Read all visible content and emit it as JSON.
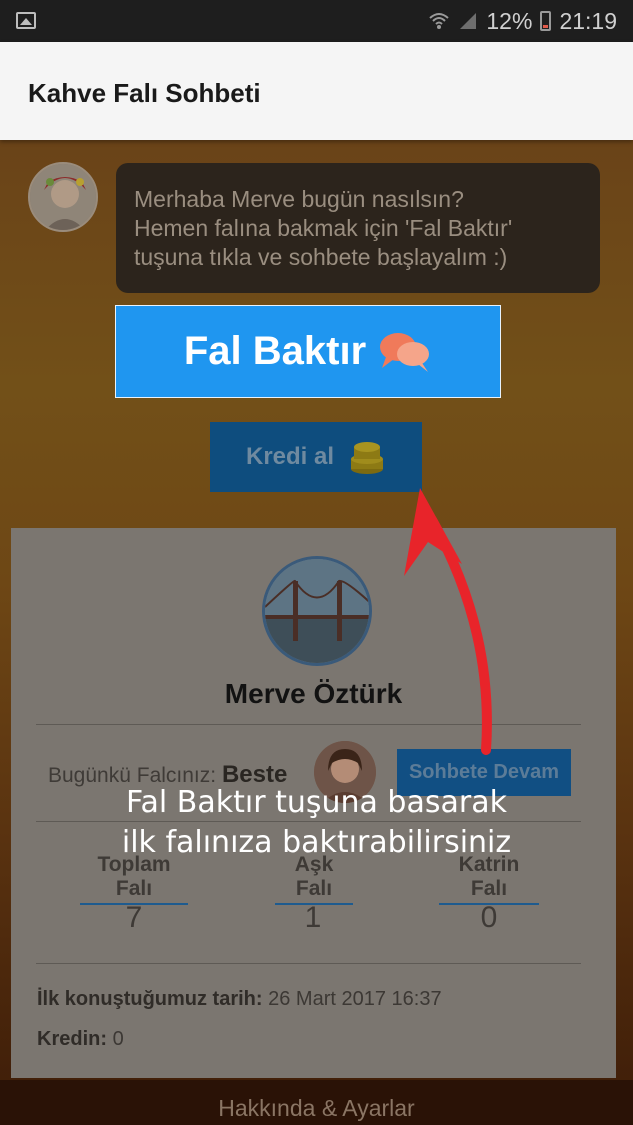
{
  "status_bar": {
    "battery": "12%",
    "time": "21:19",
    "icons": [
      "image-icon",
      "wifi-icon",
      "signal-icon",
      "battery-icon"
    ]
  },
  "app_bar": {
    "title": "Kahve Falı Sohbeti"
  },
  "chat": {
    "line1": "Merhaba  Merve      bugün nasılsın?",
    "line2": "Hemen falına bakmak için 'Fal Baktır'",
    "line3": "tuşuna tıkla ve sohbete başlayalım :)"
  },
  "buttons": {
    "fal_baktir": "Fal Baktır",
    "kredi_al": "Kredi al",
    "sohbete_devam": "Sohbete Devam"
  },
  "profile": {
    "name": "Merve Öztürk",
    "falci_label": "Bugünkü Falcınız:",
    "falci_name": "Beste",
    "stats": [
      {
        "label": "Toplam Falı",
        "value": "7"
      },
      {
        "label": "Aşk Falı",
        "value": "1"
      },
      {
        "label": "Katrin Falı",
        "value": "0"
      }
    ],
    "first_talk_label": "İlk konuştuğumuz tarih:",
    "first_talk_date": "26 Mart 2017 16:37",
    "credit_label": "Kredin:",
    "credit_value": "0"
  },
  "bottom_bar": {
    "label": "Hakkında & Ayarlar"
  },
  "tutorial_caption": {
    "line1": "Fal Baktır tuşuna basarak",
    "line2": "ilk falınıza baktırabilirsiniz"
  },
  "colors": {
    "fal_button": "#1f96f0",
    "arrow": "#e8242a",
    "app_bar": "#f5f5f5"
  }
}
